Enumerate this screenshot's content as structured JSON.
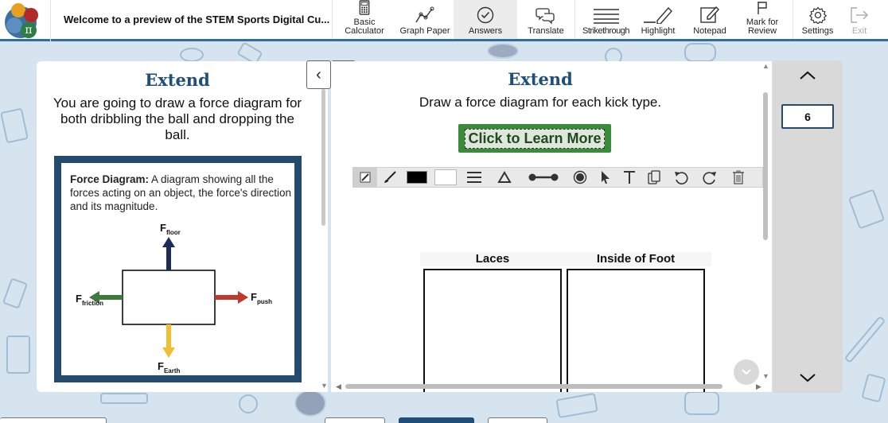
{
  "header": {
    "title": "Welcome to a preview of the STEM Sports Digital Cu..."
  },
  "toolbar": {
    "items": [
      {
        "id": "basic-calculator",
        "label": "Basic\nCalculator",
        "icon": "calculator-icon"
      },
      {
        "id": "graph-paper",
        "label": "Graph Paper",
        "icon": "graph-icon"
      },
      {
        "id": "answers",
        "label": "Answers",
        "icon": "check-circle-icon"
      },
      {
        "id": "translate",
        "label": "Translate",
        "icon": "translate-icon"
      },
      {
        "id": "strikethrough",
        "label": "Strikethrough",
        "icon": "strikethrough-icon"
      },
      {
        "id": "highlight",
        "label": "Highlight",
        "icon": "highlighter-icon"
      },
      {
        "id": "notepad",
        "label": "Notepad",
        "icon": "notepad-icon"
      },
      {
        "id": "mark-for-review",
        "label": "Mark for\nReview",
        "icon": "flag-icon"
      },
      {
        "id": "settings",
        "label": "Settings",
        "icon": "gear-icon"
      },
      {
        "id": "exit",
        "label": "Exit",
        "icon": "exit-icon"
      }
    ]
  },
  "left": {
    "heading": "Extend",
    "text": "You are going to draw a force diagram for both dribbling the ball and dropping the ball.",
    "definition_term": "Force Diagram:",
    "definition_body": " A diagram showing all the forces acting on an object, the force's direction and its magnitude.",
    "diagram": {
      "floor_label": "F",
      "floor_sub": "floor",
      "friction_label": "F",
      "friction_sub": "friction",
      "push_label": "F",
      "push_sub": "push",
      "earth_label": "F",
      "earth_sub": "Earth",
      "colors": {
        "up": "#1c2b57",
        "left": "#3f7a3c",
        "right": "#c0392b",
        "down": "#f0c030"
      }
    }
  },
  "nav": {
    "prev": "‹",
    "next": "›"
  },
  "right": {
    "heading": "Extend",
    "text": "Draw a force diagram for each kick type.",
    "learn_button": "Click to Learn More",
    "table_headers": [
      "Laces",
      "Inside of Foot"
    ]
  },
  "question": {
    "number": "6"
  },
  "colors": {
    "accent": "#2f6ea5",
    "heading": "#1f4e79",
    "button": "#3a8b3a",
    "frame": "#244a6e"
  }
}
